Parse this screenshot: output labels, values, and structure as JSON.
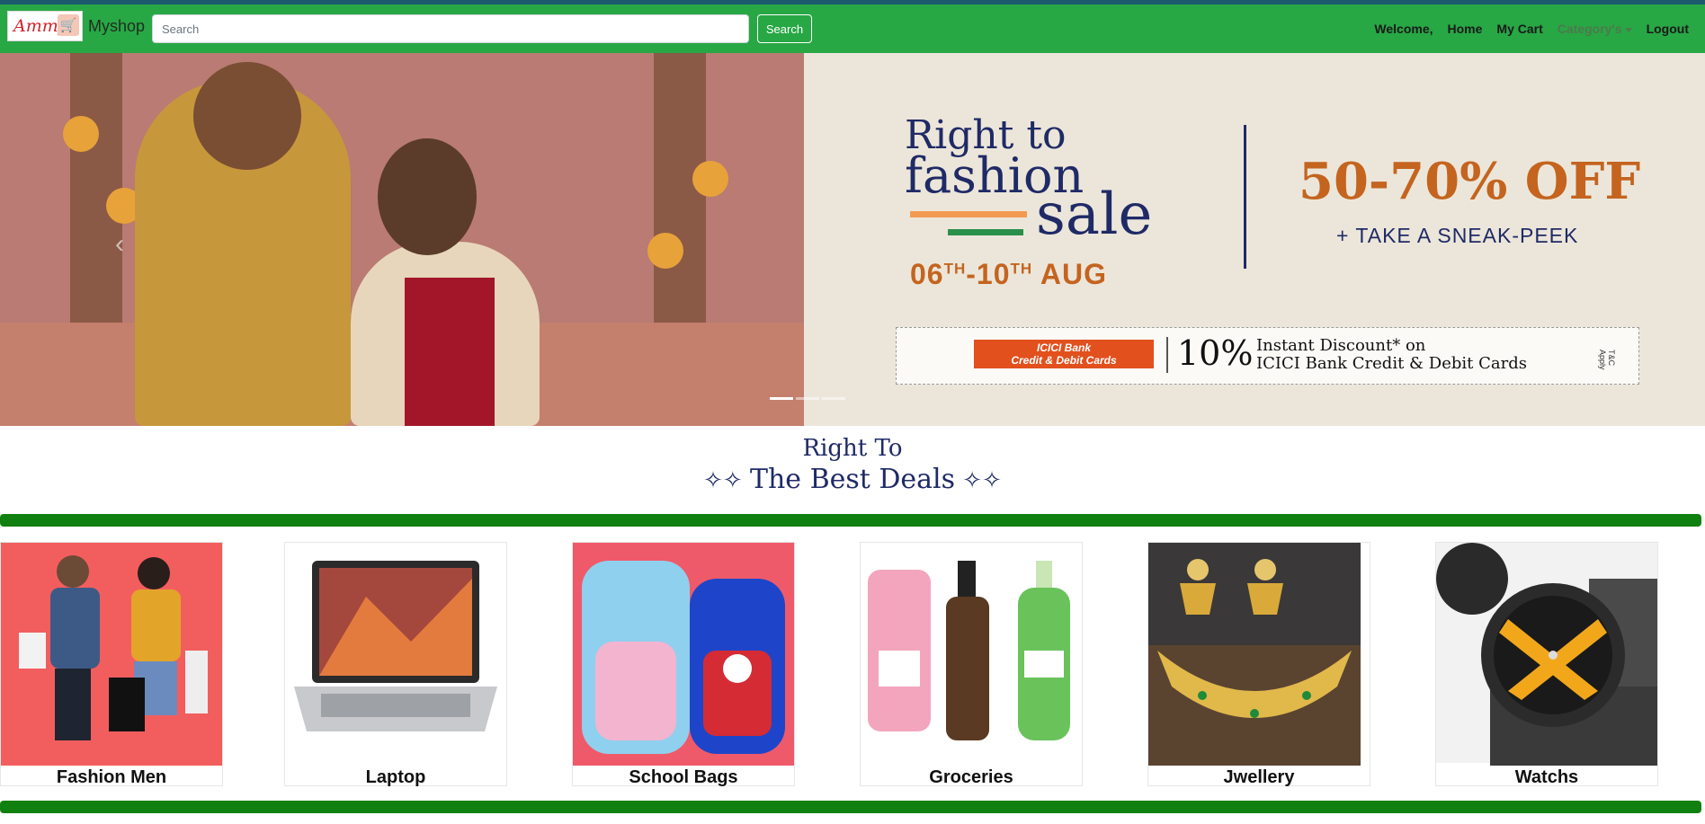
{
  "navbar": {
    "logo_text": "Ammy",
    "brand_name": "Myshop",
    "search_placeholder": "Search",
    "search_button": "Search",
    "links": {
      "welcome": "Welcome,",
      "home": "Home",
      "cart": "My Cart",
      "category": "Category's",
      "logout": "Logout"
    }
  },
  "carousel": {
    "title_line1": "Right to",
    "title_line2": "fashion",
    "title_line3": "sale",
    "date_prefix": "06",
    "date_sup1": "TH",
    "date_mid": "-10",
    "date_sup2": "TH",
    "date_suffix": " AUG",
    "discount": "50-70% OFF",
    "sneak_peek": "+ TAKE A SNEAK-PEEK",
    "bank_badge_line1": "ICICI Bank",
    "bank_badge_line2": "Credit & Debit Cards",
    "bank_percent": "10%",
    "bank_text_line1": "Instant Discount* on",
    "bank_text_line2": "ICICI Bank Credit & Debit Cards",
    "tc": "T&C Apply",
    "slide_count": 3,
    "active_slide": 1
  },
  "deals": {
    "line1": "Right To",
    "line2": "The Best Deals"
  },
  "categories": [
    {
      "label": "Fashion Men",
      "icon": "fashion-image"
    },
    {
      "label": "Laptop",
      "icon": "laptop-image"
    },
    {
      "label": "School Bags",
      "icon": "school-bags-image"
    },
    {
      "label": "Groceries",
      "icon": "groceries-image"
    },
    {
      "label": "Jwellery",
      "icon": "jewellery-image"
    },
    {
      "label": "Watchs",
      "icon": "watch-image"
    }
  ],
  "colors": {
    "navbar": "#28a745",
    "separator": "#108010",
    "brand_navy": "#1f2a66",
    "accent_orange": "#c4641f"
  }
}
